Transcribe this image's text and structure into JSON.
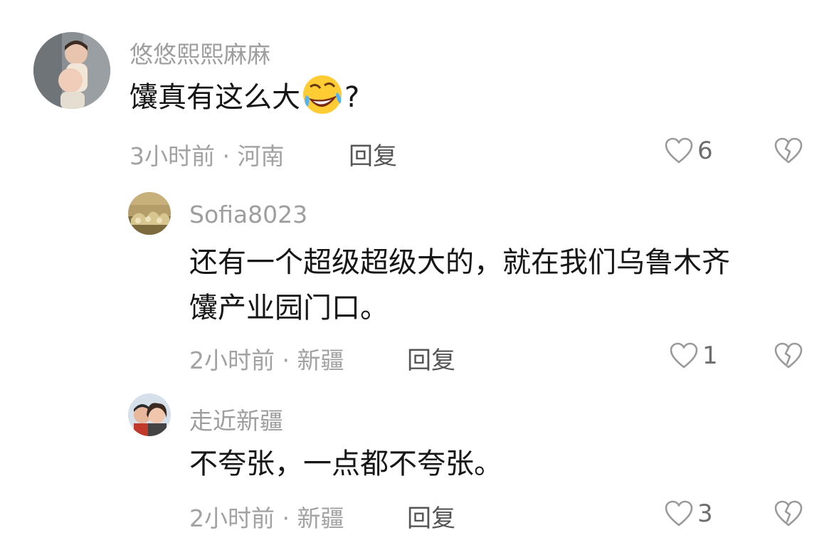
{
  "colors": {
    "name": "#9e9e9e",
    "text": "#161616",
    "meta": "#a2a2a2",
    "reply": "#555555",
    "count": "#6d6d6d"
  },
  "comments": [
    {
      "user": "悠悠熙熙麻麻",
      "text_before": "馕真有这么大",
      "emoji": "rofl-emoji",
      "text_after": "?",
      "time": "3小时前 · 河南",
      "reply_label": "回复",
      "likes": "6"
    },
    {
      "user": "Sofia8023",
      "text_lines": [
        "还有一个超级超级大的，就在我们乌鲁木齐",
        "馕产业园门口。"
      ],
      "time": "2小时前 · 新疆",
      "reply_label": "回复",
      "likes": "1"
    },
    {
      "user": "走近新疆",
      "text_lines": [
        "不夸张，一点都不夸张。"
      ],
      "time": "2小时前 · 新疆",
      "reply_label": "回复",
      "likes": "3"
    }
  ]
}
